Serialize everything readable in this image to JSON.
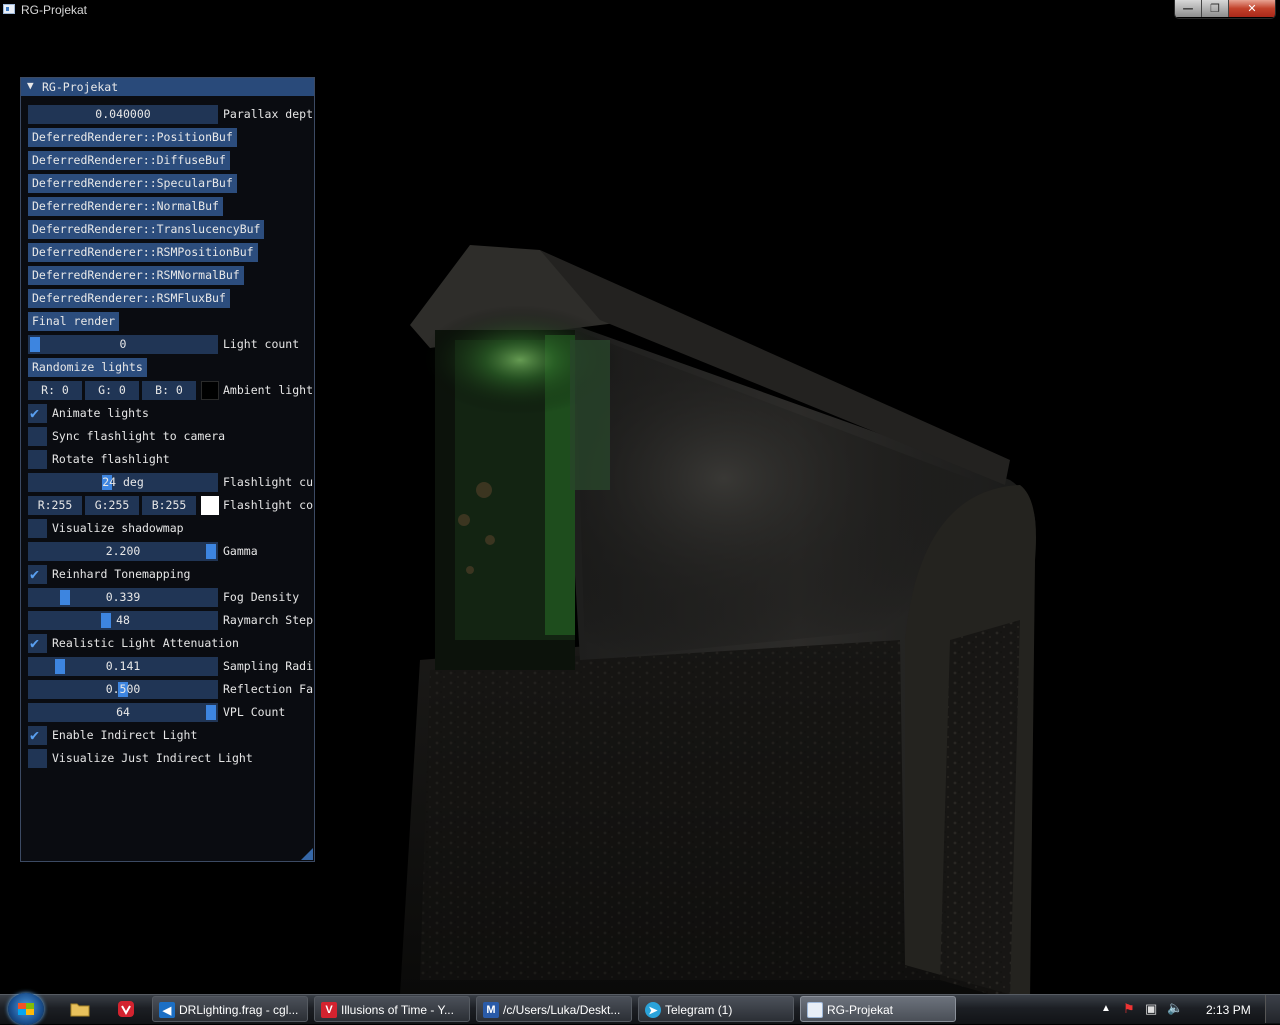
{
  "window": {
    "title": "RG-Projekat",
    "min_label": "—",
    "max_label": "❐",
    "close_label": "✕"
  },
  "panel": {
    "title": "RG-Projekat",
    "parallax": {
      "value": "0.040000",
      "label": "Parallax dept"
    },
    "buffer_buttons": [
      "DeferredRenderer::PositionBuf",
      "DeferredRenderer::DiffuseBuf",
      "DeferredRenderer::SpecularBuf",
      "DeferredRenderer::NormalBuf",
      "DeferredRenderer::TranslucencyBuf",
      "DeferredRenderer::RSMPositionBuf",
      "DeferredRenderer::RSMNormalBuf",
      "DeferredRenderer::RSMFluxBuf"
    ],
    "final_render": "Final render",
    "light_count": {
      "value": "0",
      "label": "Light count",
      "fraction": 0.0
    },
    "randomize_lights": "Randomize lights",
    "ambient": {
      "r": "R:  0",
      "g": "G:  0",
      "b": "B:  0",
      "label": "Ambient light",
      "color": "#000000"
    },
    "animate_lights": {
      "label": "Animate lights",
      "checked": true
    },
    "sync_flashlight": {
      "label": "Sync flashlight to camera",
      "checked": false
    },
    "rotate_flashlight": {
      "label": "Rotate flashlight",
      "checked": false
    },
    "flashlight_cutoff": {
      "value": "24 deg",
      "label": "Flashlight cu"
    },
    "flashlight_color": {
      "r": "R:255",
      "g": "G:255",
      "b": "B:255",
      "label": "Flashlight co",
      "color": "#ffffff"
    },
    "visualize_shadowmap": {
      "label": "Visualize shadowmap",
      "checked": false
    },
    "gamma": {
      "value": "2.200",
      "label": "Gamma"
    },
    "reinhard": {
      "label": "Reinhard Tonemapping",
      "checked": true
    },
    "fog_density": {
      "value": "0.339",
      "label": "Fog Density"
    },
    "raymarch_steps": {
      "value": "48",
      "label": "Raymarch Step"
    },
    "realistic_attenuation": {
      "label": "Realistic Light Attenuation",
      "checked": true
    },
    "sampling_radius": {
      "value": "0.141",
      "label": "Sampling Radi"
    },
    "reflection_factor": {
      "value": "0.500",
      "label": "Reflection Fa"
    },
    "vpl_count": {
      "value": "64",
      "label": "VPL Count"
    },
    "enable_indirect": {
      "label": "Enable Indirect Light",
      "checked": true
    },
    "just_indirect": {
      "label": "Visualize Just Indirect Light",
      "checked": false
    }
  },
  "taskbar": {
    "tasks": [
      {
        "label": "DRLighting.frag - cgl...",
        "icon": "vscode-icon"
      },
      {
        "label": "Illusions of Time - Y...",
        "icon": "vivaldi-icon"
      },
      {
        "label": "/c/Users/Luka/Deskt...",
        "icon": "msys-terminal-icon"
      },
      {
        "label": "Telegram (1)",
        "icon": "telegram-icon"
      },
      {
        "label": "RG-Projekat",
        "icon": "app-window-icon"
      }
    ],
    "clock": "2:13 PM"
  },
  "colors": {
    "imgui_header": "#294a7a",
    "imgui_button": "#2c4d7d",
    "imgui_frame": "#203555",
    "imgui_grab": "#3d85e0",
    "check_mark": "#5aa0f0"
  }
}
